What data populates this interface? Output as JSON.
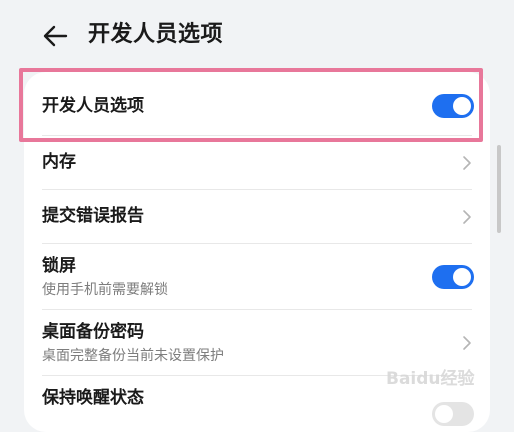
{
  "header": {
    "title": "开发人员选项",
    "back_icon": "arrow-left-icon"
  },
  "settings": {
    "developer_options": {
      "label": "开发人员选项",
      "enabled": true
    },
    "memory": {
      "label": "内存"
    },
    "bug_report": {
      "label": "提交错误报告"
    },
    "screen_lock": {
      "label": "锁屏",
      "description": "使用手机前需要解锁",
      "enabled": true
    },
    "desktop_backup_password": {
      "label": "桌面备份密码",
      "description": "桌面完整备份当前未设置保护"
    },
    "stay_awake": {
      "label": "保持唤醒状态",
      "enabled": false
    }
  },
  "watermark": {
    "text": "Baidu经验"
  },
  "colors": {
    "accent": "#1e6ff0",
    "highlight": "#e8779a",
    "background": "#f1f3f5"
  }
}
